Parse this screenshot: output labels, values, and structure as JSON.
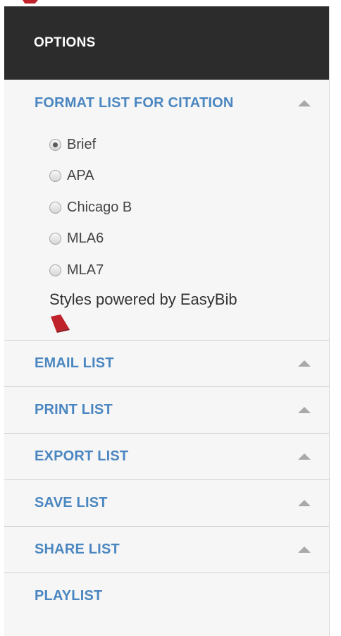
{
  "panel": {
    "title": "OPTIONS"
  },
  "format_section": {
    "title": "FORMAT LIST FOR CITATION",
    "options": [
      {
        "label": "Brief",
        "checked": true
      },
      {
        "label": "APA",
        "checked": false
      },
      {
        "label": "Chicago B",
        "checked": false
      },
      {
        "label": "MLA6",
        "checked": false
      },
      {
        "label": "MLA7",
        "checked": false
      }
    ],
    "powered_by": "Styles powered by EasyBib",
    "logo_icon": "easybib-logo-icon"
  },
  "sections": [
    {
      "title": "EMAIL LIST",
      "has_caret": true
    },
    {
      "title": "PRINT LIST",
      "has_caret": true
    },
    {
      "title": "EXPORT LIST",
      "has_caret": true
    },
    {
      "title": "SAVE LIST",
      "has_caret": true
    },
    {
      "title": "SHARE LIST",
      "has_caret": true
    },
    {
      "title": "PLAYLIST",
      "has_caret": false
    }
  ],
  "colors": {
    "header_bg": "#2c2c2c",
    "section_title": "#4a86c0",
    "panel_bg": "#f6f6f6",
    "logo_red": "#c0222c"
  }
}
